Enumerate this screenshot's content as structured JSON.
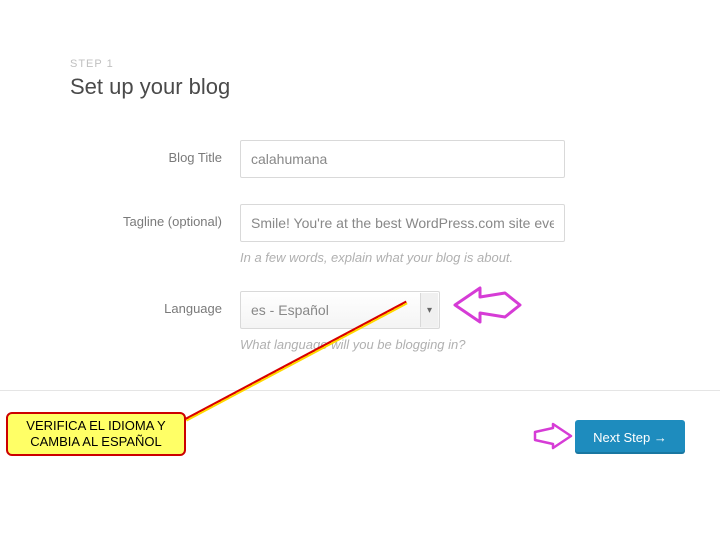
{
  "step_label": "STEP 1",
  "page_title": "Set up your blog",
  "fields": {
    "blog_title": {
      "label": "Blog Title",
      "value": "calahumana"
    },
    "tagline": {
      "label": "Tagline (optional)",
      "value": "Smile! You're at the best WordPress.com site ever",
      "hint": "In a few words, explain what your blog is about."
    },
    "language": {
      "label": "Language",
      "value": "es - Español",
      "hint": "What language will you be blogging in?"
    }
  },
  "next_button": "Next Step →",
  "callout_text": "VERIFICA EL IDIOMA Y CAMBIA AL ESPAÑOL"
}
